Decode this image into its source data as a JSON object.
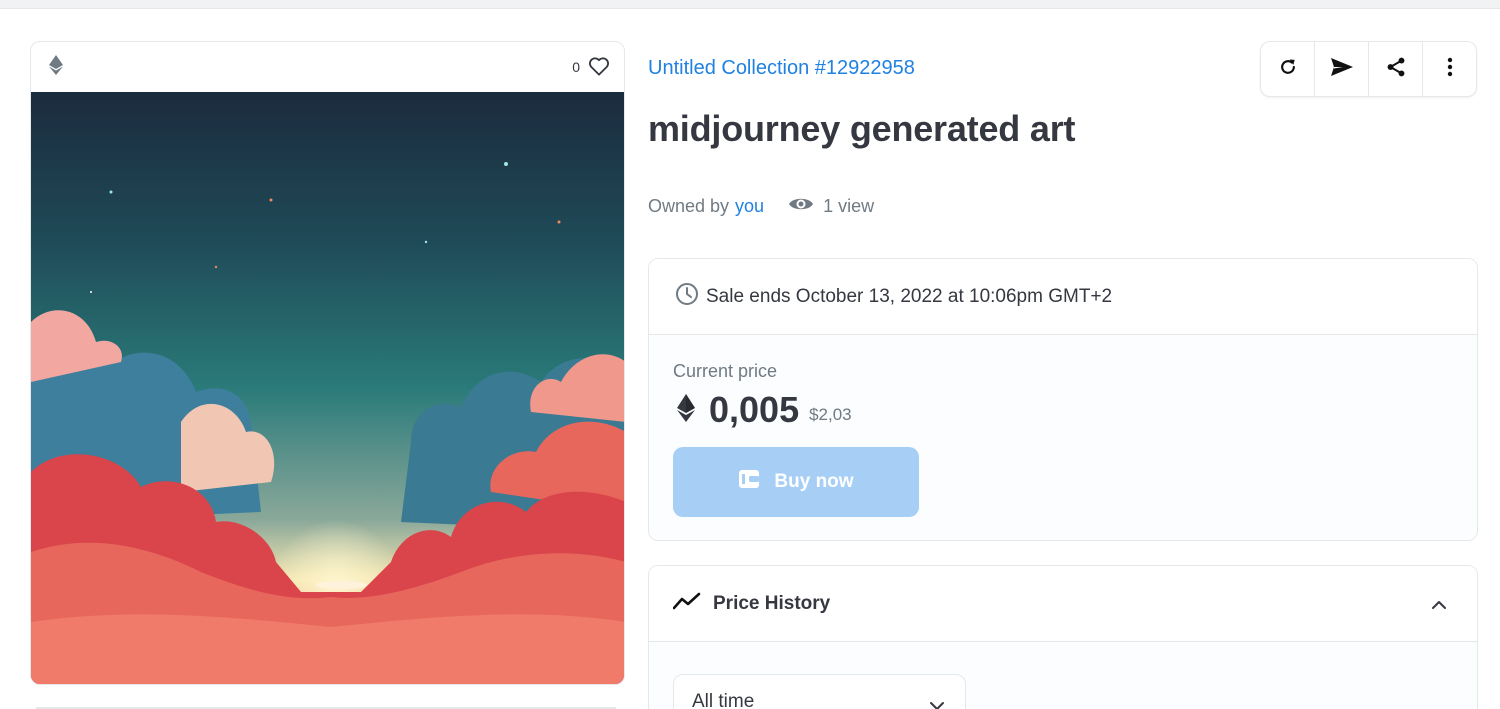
{
  "media": {
    "chain_icon": "ethereum-icon",
    "favorites_count": "0",
    "favorite_icon": "heart-icon",
    "image_alt": "midjourney generated art"
  },
  "item": {
    "collection_name": "Untitled Collection #12922958",
    "title": "midjourney generated art",
    "owned_by_label": "Owned by",
    "owner": "you",
    "views": "1 view"
  },
  "actions": [
    {
      "name": "refresh-icon"
    },
    {
      "name": "transfer-icon"
    },
    {
      "name": "share-icon"
    },
    {
      "name": "more-icon"
    }
  ],
  "sale": {
    "ends_text": "Sale ends October 13, 2022 at 10:06pm GMT+2",
    "current_price_label": "Current price",
    "price": "0,005",
    "fiat_price": "$2,03",
    "buy_label": "Buy now"
  },
  "history": {
    "title": "Price History",
    "range_value": "All time"
  },
  "colors": {
    "accent": "#2081e2",
    "buy_button_disabled": "#a7cff6",
    "text_primary": "#353840",
    "text_secondary": "#707a83",
    "border": "#e5e8eb"
  }
}
